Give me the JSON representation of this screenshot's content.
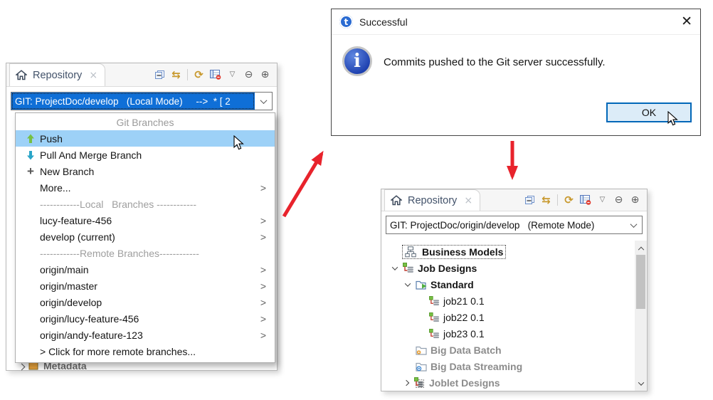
{
  "glyphs": {
    "sync": "⇆",
    "refresh": "⟳",
    "view_menu": "▽",
    "minimize": "⊖",
    "maximize": "⊕",
    "tab_close": "×",
    "dialog_close": "✕",
    "info": "i",
    "talend": "t",
    "new_branch_plus": "+",
    "submenu": "›"
  },
  "colors": {
    "selection_blue": "#0f6fd7",
    "menu_highlight": "#9dd1f7",
    "arrow_red": "#e8232c",
    "toolbar_gold": "#c8992e",
    "muted_tree": "#8c8c8c",
    "ok_border": "#0067b8"
  },
  "left_panel": {
    "tab_label": "Repository",
    "toolbar_icons": [
      "collapse-all",
      "sync-branches",
      "refresh",
      "show-details",
      "view-menu",
      "minimize",
      "maximize"
    ],
    "combo_value": "GIT: ProjectDoc/develop   (Local Mode)     -->  * [ 2",
    "menu": {
      "header": "Git Branches",
      "actions": [
        {
          "label": "Push",
          "icon": "push-arrow-up",
          "highlighted": true
        },
        {
          "label": "Pull And Merge Branch",
          "icon": "pull-arrow-down"
        },
        {
          "label": "New Branch",
          "icon": "plus"
        },
        {
          "label": "More...",
          "submenu": true
        }
      ],
      "local_separator": "------------Local   Branches ------------",
      "local_branches": [
        "lucy-feature-456",
        "develop (current)"
      ],
      "remote_separator": "------------Remote Branches------------",
      "remote_branches": [
        "origin/main",
        "origin/master",
        "origin/develop",
        "origin/lucy-feature-456",
        "origin/andy-feature-123"
      ],
      "more_remote_link": "> Click for more remote branches..."
    },
    "background_tree_item": "Metadata"
  },
  "dialog": {
    "title": "Successful",
    "message": "Commits pushed to the Git server successfully.",
    "ok_label": "OK"
  },
  "right_panel": {
    "tab_label": "Repository",
    "combo_value": "GIT: ProjectDoc/origin/develop   (Remote Mode)",
    "tree_items": [
      {
        "label": "Business Models",
        "level": 0,
        "expander": "none",
        "focused": true
      },
      {
        "label": "Job Designs",
        "level": 0,
        "expander": "expanded"
      },
      {
        "label": "Standard",
        "level": 1,
        "expander": "expanded"
      },
      {
        "label": "job21 0.1",
        "level": 2
      },
      {
        "label": "job22 0.1",
        "level": 2
      },
      {
        "label": "job23 0.1",
        "level": 2
      },
      {
        "label": "Big Data Batch",
        "level": 1,
        "muted": true
      },
      {
        "label": "Big Data Streaming",
        "level": 1,
        "muted": true
      },
      {
        "label": "Joblet Designs",
        "level": 0,
        "expander": "collapsed",
        "muted": true
      }
    ]
  }
}
